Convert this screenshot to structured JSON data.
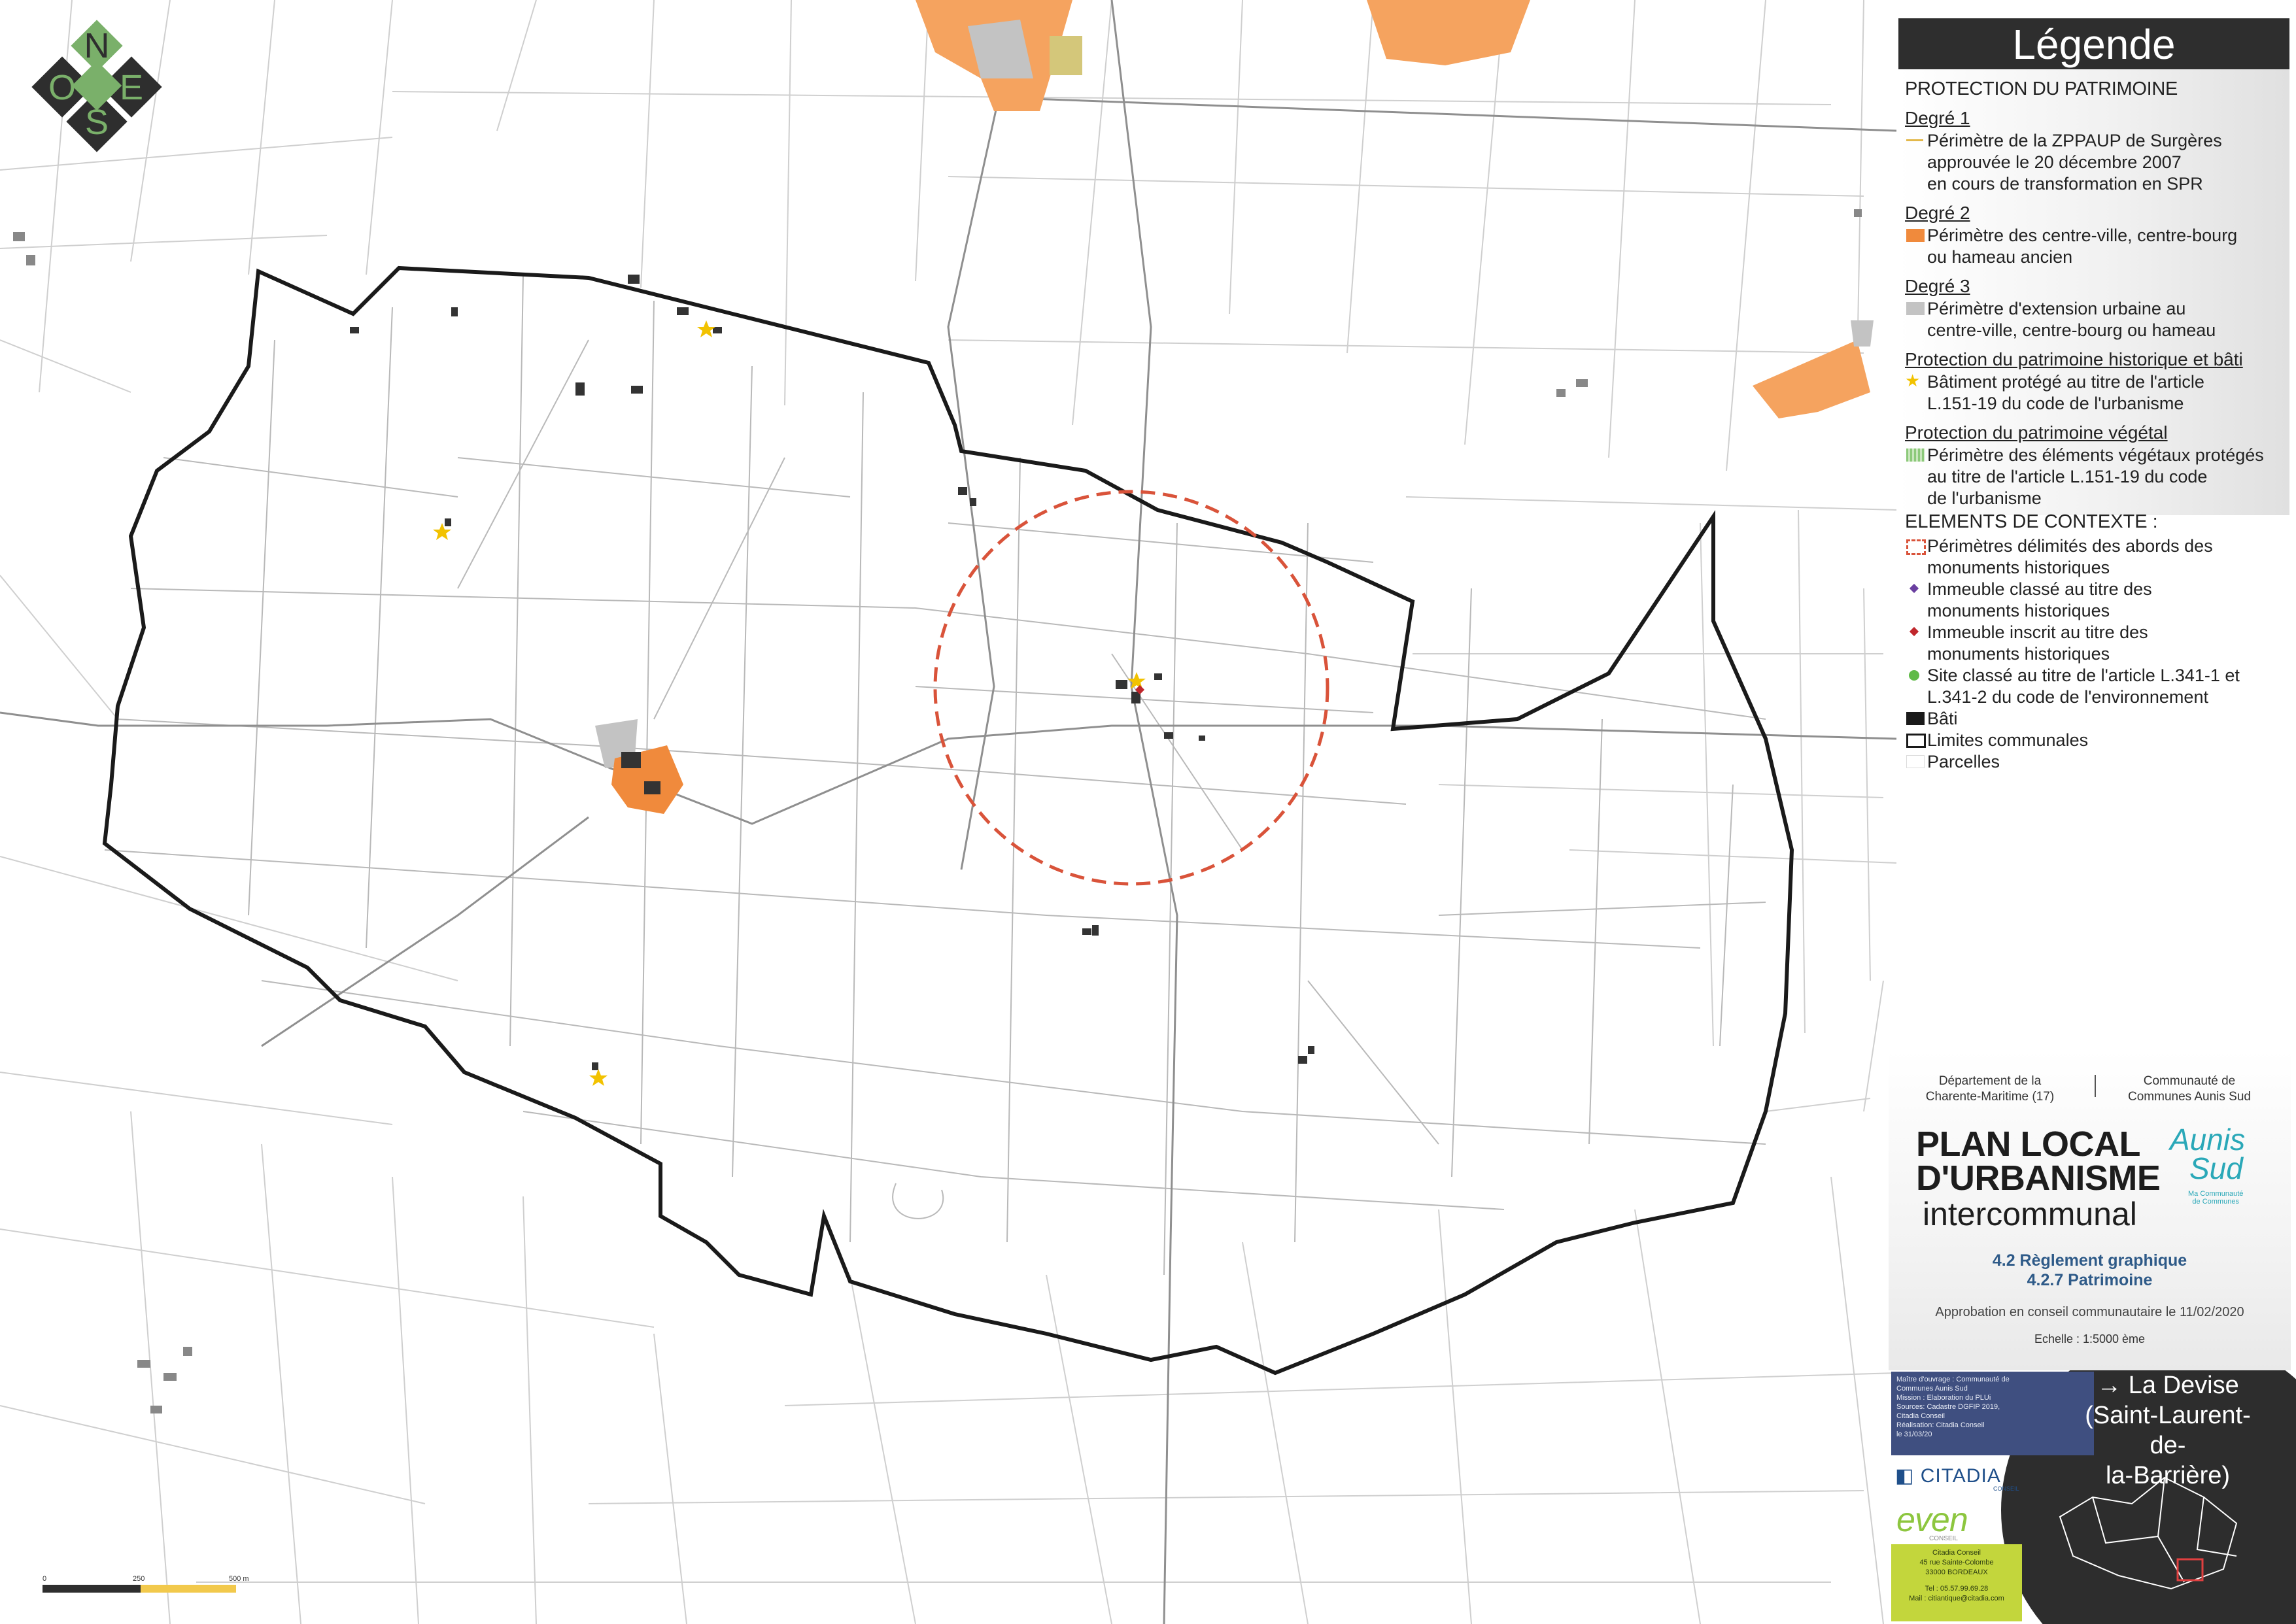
{
  "compass": {
    "n": "N",
    "o": "O",
    "e": "E",
    "s": "S"
  },
  "legend": {
    "title": "Légende",
    "section1": "PROTECTION DU PATRIMOINE",
    "deg1": {
      "label": "Degré 1",
      "items": [
        "Périmètre de la ZPPAUP de Surgères",
        "approuvée le 20 décembre 2007",
        "en cours de transformation en SPR"
      ]
    },
    "deg2": {
      "label": "Degré 2",
      "items": [
        "Périmètre des centre-ville, centre-bourg",
        "ou hameau ancien"
      ]
    },
    "deg3": {
      "label": "Degré 3",
      "items": [
        "Périmètre d'extension urbaine au",
        "centre-ville, centre-bourg ou hameau"
      ]
    },
    "hist": {
      "label": "Protection du patrimoine historique et bâti",
      "items": [
        "Bâtiment protégé au titre de l'article",
        "L.151-19 du code de l'urbanisme"
      ]
    },
    "veg": {
      "label": "Protection du patrimoine végétal",
      "items": [
        "Périmètre des éléments végétaux protégés",
        "au titre de l'article L.151-19 du code",
        "de l'urbanisme"
      ]
    },
    "section2": "ELEMENTS DE CONTEXTE :",
    "ctx": [
      {
        "lines": [
          "Périmètres délimités des abords des",
          "monuments historiques"
        ]
      },
      {
        "lines": [
          "Immeuble classé au titre des",
          "monuments historiques"
        ]
      },
      {
        "lines": [
          "Immeuble inscrit au titre des",
          "monuments historiques"
        ]
      },
      {
        "lines": [
          "Site classé au titre de l'article L.341-1 et",
          "L.341-2 du code de l'environnement"
        ]
      },
      {
        "lines": [
          "Bâti"
        ]
      },
      {
        "lines": [
          "Limites communales"
        ]
      },
      {
        "lines": [
          "Parcelles"
        ]
      }
    ]
  },
  "colors": {
    "zppaup": "#e3b84a",
    "degre2": "#f08a3c",
    "degre3": "#c3c3c3",
    "vegetal": "#8cc97a",
    "abords": "#d9533a",
    "classe": "#6a3fa0",
    "inscrit": "#c0272d",
    "site": "#5fba47",
    "bati": "#1a1a1a",
    "commune": "#1a1a1a",
    "parcel": "#bfbfbf"
  },
  "cartouche": {
    "dept": [
      "Département de la",
      "Charente-Maritime (17)"
    ],
    "cc": [
      "Communauté de",
      "Communes Aunis Sud"
    ],
    "plu": [
      "PLAN LOCAL",
      "D'URBANISME"
    ],
    "plu2": "intercommunal",
    "logo": [
      "Aunis",
      "Sud"
    ],
    "logo_sub": [
      "Ma Communauté",
      "de Communes"
    ],
    "reg1": "4.2 Règlement graphique",
    "reg2": "4.2.7 Patrimoine",
    "approbation": "Approbation en conseil communautaire le 11/02/2020",
    "echelle": "Echelle : 1:5000    ème"
  },
  "credits": {
    "lines": [
      "Maître d'ouvrage : Communauté de",
      "Communes Aunis Sud",
      "Mission : Elaboration du PLUi",
      "Sources: Cadastre DGFIP 2019,",
      "Citadia Conseil",
      "Réalisation: Citadia Conseil",
      "le 31/03/20"
    ],
    "citadia": "CITADIA",
    "citadia_sub": "CONSEIL",
    "even": "even",
    "even_sub": "CONSEIL",
    "contact": [
      "Citadia Conseil",
      "45 rue Sainte-Colombe",
      "33000 BORDEAUX",
      "",
      "Tel : 05.57.99.69.28",
      "Mail : citiantique@citadia.com"
    ]
  },
  "place": [
    "→ La Devise",
    "(Saint-Laurent-de-",
    "la-Barrière)"
  ],
  "scalebar": {
    "labels": [
      "0",
      "250",
      "500 m"
    ]
  }
}
